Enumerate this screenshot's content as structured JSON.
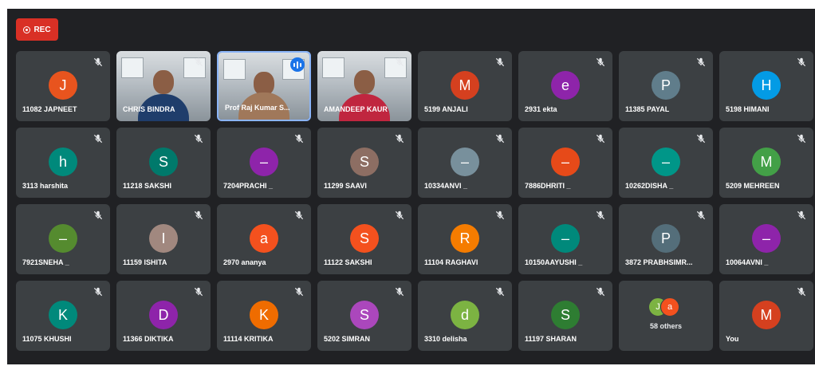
{
  "recording": {
    "label": "REC",
    "color": "#d93025"
  },
  "colors": {
    "background": "#202124",
    "tile": "#3c4043",
    "active_border": "#8ab4f8",
    "speaking": "#1a73e8"
  },
  "participants": [
    {
      "name": "11082 JAPNEET",
      "initial": "J",
      "color": "#e8541e",
      "muted": true
    },
    {
      "name": "CHRIS BINDRA",
      "video": true,
      "muted": true
    },
    {
      "name": "Prof Raj Kumar S...",
      "video": true,
      "speaking": true
    },
    {
      "name": "AMANDEEP KAUR",
      "video": true,
      "muted": true
    },
    {
      "name": "5199 ANJALI",
      "initial": "M",
      "color": "#d5401f",
      "muted": true
    },
    {
      "name": "2931 ekta",
      "initial": "e",
      "color": "#8e24aa",
      "muted": true
    },
    {
      "name": "11385 PAYAL",
      "initial": "P",
      "color": "#607d8b",
      "muted": true
    },
    {
      "name": "5198 HIMANI",
      "initial": "H",
      "color": "#039be5",
      "muted": true
    },
    {
      "name": "3113 harshita",
      "initial": "h",
      "color": "#00897b",
      "muted": true
    },
    {
      "name": "11218 SAKSHI",
      "initial": "S",
      "color": "#00796b",
      "muted": true
    },
    {
      "name": "7204PRACHI _",
      "initial": "–",
      "color": "#8e24aa",
      "muted": true
    },
    {
      "name": "11299 SAAVI",
      "initial": "S",
      "color": "#8d6e63",
      "muted": true
    },
    {
      "name": "10334ANVI _",
      "initial": "–",
      "color": "#78909c",
      "muted": true
    },
    {
      "name": "7886DHRITI _",
      "initial": "–",
      "color": "#e64a19",
      "muted": true
    },
    {
      "name": "10262DISHA _",
      "initial": "–",
      "color": "#009688",
      "muted": true
    },
    {
      "name": "5209 MEHREEN",
      "initial": "M",
      "color": "#43a047",
      "muted": true
    },
    {
      "name": "7921SNEHA _",
      "initial": "–",
      "color": "#558b2f",
      "muted": true
    },
    {
      "name": "11159 ISHITA",
      "initial": "I",
      "color": "#a1887f",
      "muted": true
    },
    {
      "name": "2970 ananya",
      "initial": "a",
      "color": "#f4511e",
      "muted": true
    },
    {
      "name": "11122 SAKSHI",
      "initial": "S",
      "color": "#f4511e",
      "muted": true
    },
    {
      "name": "11104 RAGHAVI",
      "initial": "R",
      "color": "#f57c00",
      "muted": true
    },
    {
      "name": "10150AAYUSHI _",
      "initial": "–",
      "color": "#00897b",
      "muted": true
    },
    {
      "name": "3872 PRABHSIMR...",
      "initial": "P",
      "color": "#546e7a",
      "muted": true
    },
    {
      "name": "10064AVNI _",
      "initial": "–",
      "color": "#8e24aa",
      "muted": true
    },
    {
      "name": "11075 KHUSHI",
      "initial": "K",
      "color": "#00897b",
      "muted": true
    },
    {
      "name": "11366 DIKTIKA",
      "initial": "D",
      "color": "#8e24aa",
      "muted": true
    },
    {
      "name": "11114 KRITIKA",
      "initial": "K",
      "color": "#ef6c00",
      "muted": true
    },
    {
      "name": "5202 SIMRAN",
      "initial": "S",
      "color": "#ab47bc",
      "muted": true
    },
    {
      "name": "3310 delisha",
      "initial": "d",
      "color": "#7cb342",
      "muted": true
    },
    {
      "name": "11197 SHARAN",
      "initial": "S",
      "color": "#2e7d32",
      "muted": true
    },
    {
      "name": "58 others",
      "others": true,
      "avatars": [
        {
          "initial": "J",
          "color": "#7cb342"
        },
        {
          "initial": "a",
          "color": "#f4511e"
        }
      ]
    },
    {
      "name": "You",
      "initial": "M",
      "color": "#d5401f",
      "muted": true
    }
  ]
}
